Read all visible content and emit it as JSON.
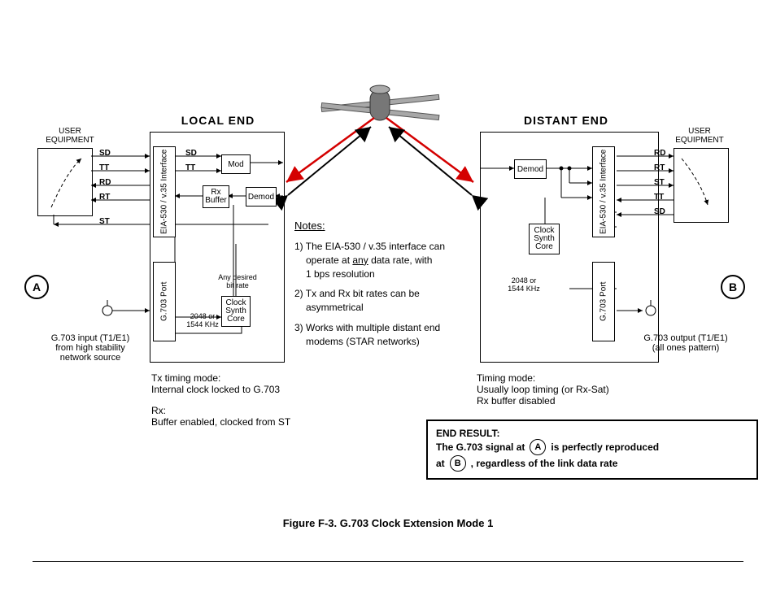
{
  "titles": {
    "local": "LOCAL END",
    "distant": "DISTANT END",
    "user_equipment": "USER\nEQUIPMENT"
  },
  "signals": {
    "sd": "SD",
    "tt": "TT",
    "rd": "RD",
    "rt": "RT",
    "st": "ST"
  },
  "blocks": {
    "mod": "Mod",
    "demod": "Demod",
    "rx_buffer": "Rx\nBuffer",
    "clock_synth": "Clock\nSynth\nCore",
    "eia_interface": "EIA-530 / v.35\nInterface",
    "g703_port": "G.703 Port"
  },
  "labels": {
    "g703_rate": "2048 or\n1544 KHz",
    "any_bit_rate": "Any desired\nbit rate",
    "g703_input": "G.703 input (T1/E1)\nfrom high stability\nnetwork source",
    "g703_output": "G.703 output (T1/E1)\n(all ones pattern)"
  },
  "notes": {
    "heading": "Notes:",
    "n1a": "1) The EIA-530 / v.35 interface can",
    "n1b_pre": "operate at ",
    "n1b_u": "any",
    "n1b_post": " data rate, with",
    "n1c": "1 bps resolution",
    "n2a": "2) Tx and Rx bit rates can be",
    "n2b": "asymmetrical",
    "n3a": "3) Works with multiple distant end",
    "n3b": "modems (STAR networks)"
  },
  "modes": {
    "tx_title": "Tx timing mode:",
    "tx_body": "Internal clock locked to G.703",
    "rx_title": "Rx:",
    "rx_body": "Buffer enabled, clocked from ST",
    "dist_title": "Timing mode:",
    "dist_body1": "Usually loop timing (or Rx-Sat)",
    "dist_body2": "Rx buffer disabled"
  },
  "result": {
    "title": "END RESULT:",
    "line_a": "The G.703 signal at",
    "line_b": "is perfectly reproduced",
    "line_c": "at",
    "line_d": ", regardless of the link data rate"
  },
  "letters": {
    "a": "A",
    "b": "B"
  },
  "caption": "Figure F-3. G.703 Clock Extension Mode 1"
}
